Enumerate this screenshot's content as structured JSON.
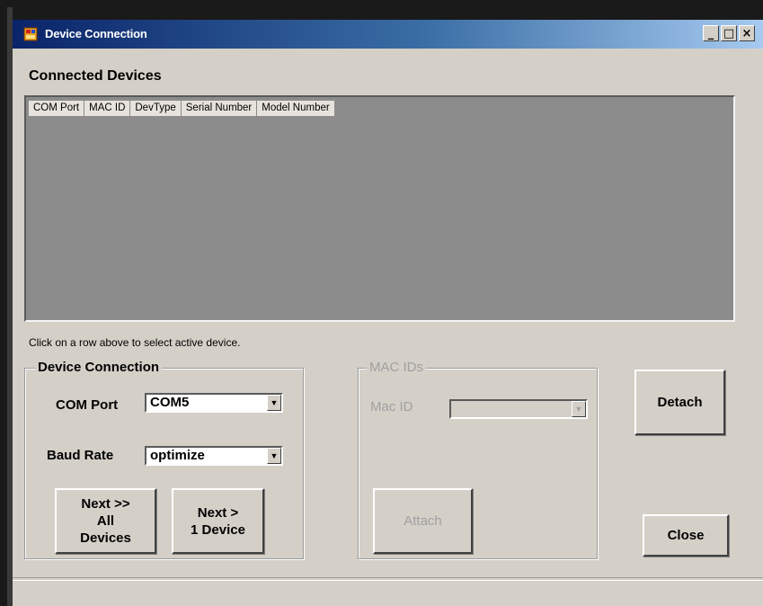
{
  "window": {
    "title": "Device Connection",
    "min_label": "_",
    "max_label": "□",
    "close_label": "×"
  },
  "connected_devices": {
    "heading": "Connected Devices",
    "columns": [
      "COM Port",
      "MAC ID",
      "DevType",
      "Serial Number",
      "Model Number"
    ],
    "rows": []
  },
  "hint": "Click on a row above to select active device.",
  "device_connection": {
    "group_label": "Device Connection",
    "com_port_label": "COM Port",
    "com_port_value": "COM5",
    "baud_rate_label": "Baud Rate",
    "baud_rate_value": "optimize",
    "next_all_label": "Next >>\nAll\nDevices",
    "next_one_label": "Next >\n1 Device"
  },
  "mac_ids": {
    "group_label": "MAC IDs",
    "mac_id_label": "Mac ID",
    "mac_id_value": "",
    "attach_label": "Attach"
  },
  "buttons": {
    "detach_label": "Detach",
    "close_label": "Close"
  },
  "colors": {
    "title_start": "#0a246a",
    "title_end": "#a6caf0",
    "face": "#d4d0c8",
    "grid_bg": "#8c8c8c"
  }
}
